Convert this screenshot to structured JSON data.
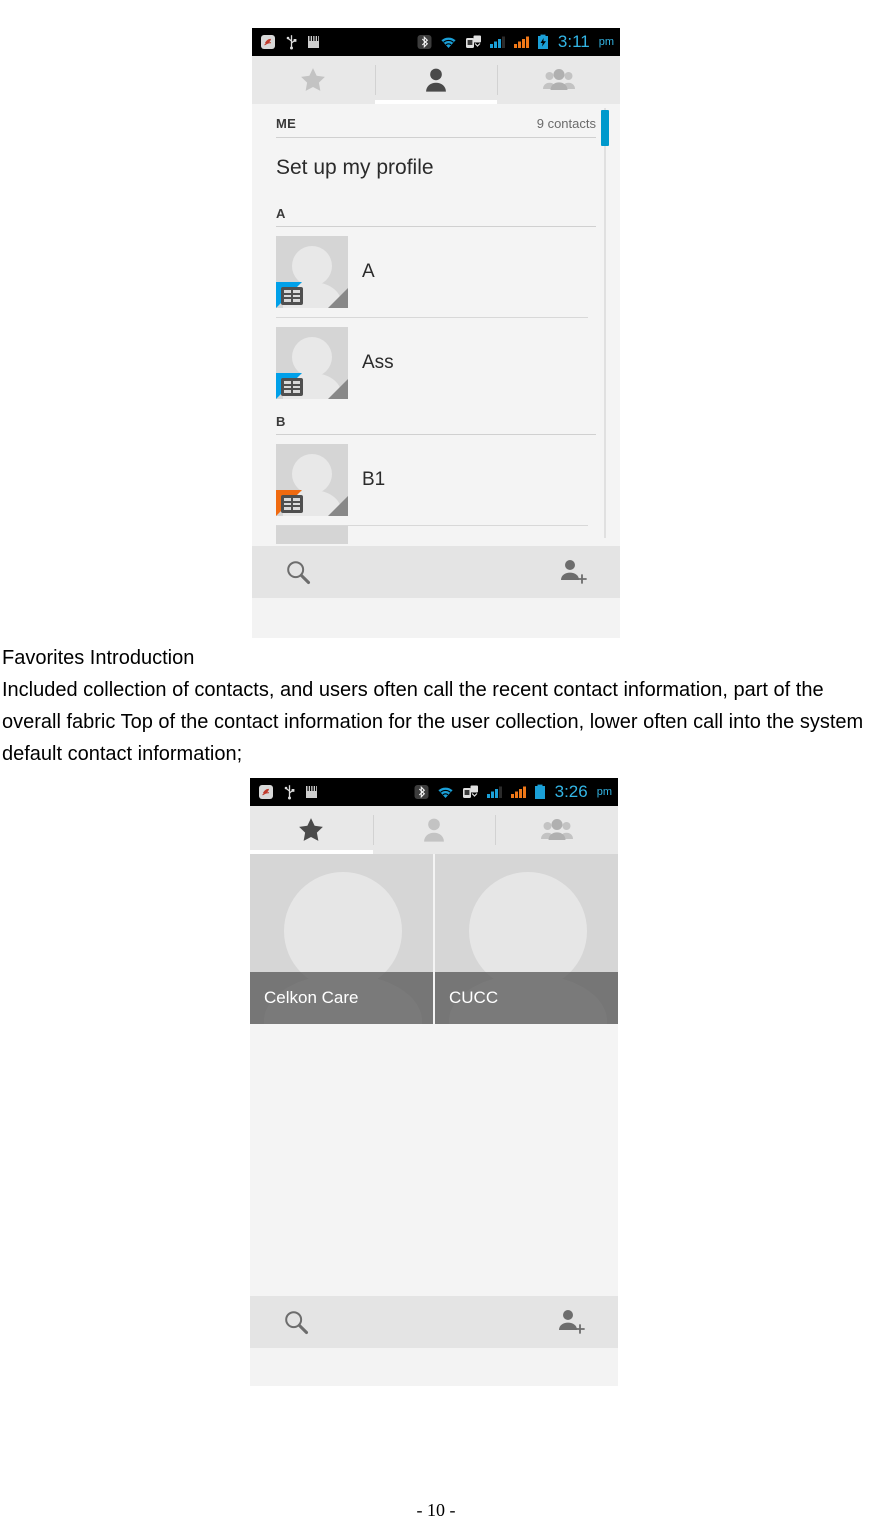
{
  "document": {
    "body_paragraphs": [
      "Favorites Introduction",
      "Included collection of contacts, and users often call the recent contact information, part of the overall fabric Top of the contact information for the user collection, lower often call into the system default contact information;"
    ],
    "heading": "Favorites Introduction",
    "paragraph": "Included collection of contacts, and users often call the recent contact information, part of the overall fabric Top of the contact information for the user collection, lower often call into the system default contact information;",
    "page_number": "- 10 -"
  },
  "screenshot_contacts": {
    "status_bar": {
      "time": "3:11",
      "ampm": "pm",
      "icons_left": [
        "app-notification-icon",
        "usb-icon",
        "sd-card-icon"
      ],
      "icons_right": [
        "bluetooth-icon",
        "wifi-icon",
        "sync-icon",
        "signal-sim1-icon",
        "signal-sim2-icon",
        "battery-charging-icon"
      ],
      "time_color": "#33b5e5",
      "battery_state": "charging"
    },
    "tabs": [
      {
        "name": "favorites",
        "icon": "star-icon",
        "active": false
      },
      {
        "name": "contacts",
        "icon": "person-icon",
        "active": true
      },
      {
        "name": "groups",
        "icon": "group-icon",
        "active": false
      }
    ],
    "active_tab_index": 1,
    "me_section": {
      "label": "ME",
      "count": "9 contacts",
      "profile_action": "Set up my profile"
    },
    "sections": [
      {
        "letter": "A",
        "contacts": [
          {
            "name": "A",
            "badge": "sim1",
            "badge_color": "#00a0e9"
          },
          {
            "name": "Ass",
            "badge": "sim1",
            "badge_color": "#00a0e9"
          }
        ]
      },
      {
        "letter": "B",
        "contacts": [
          {
            "name": "B1",
            "badge": "sim2",
            "badge_color": "#f06a10"
          }
        ]
      }
    ],
    "scrollbar": {
      "color": "#0099cc",
      "position": "top"
    },
    "action_bar": {
      "search_icon": "search-icon",
      "add_contact_icon": "add-contact-icon"
    }
  },
  "screenshot_favorites": {
    "status_bar": {
      "time": "3:26",
      "ampm": "pm",
      "icons_left": [
        "app-notification-icon",
        "usb-icon",
        "sd-card-icon"
      ],
      "icons_right": [
        "bluetooth-icon",
        "wifi-icon",
        "sync-icon",
        "signal-sim1-icon",
        "signal-sim2-icon",
        "battery-full-icon"
      ],
      "time_color": "#33b5e5",
      "battery_state": "full"
    },
    "tabs": [
      {
        "name": "favorites",
        "icon": "star-icon",
        "active": true
      },
      {
        "name": "contacts",
        "icon": "person-icon",
        "active": false
      },
      {
        "name": "groups",
        "icon": "group-icon",
        "active": false
      }
    ],
    "active_tab_index": 0,
    "favorite_tiles": [
      {
        "name": "Celkon Care"
      },
      {
        "name": "CUCC"
      }
    ],
    "action_bar": {
      "search_icon": "search-icon",
      "add_contact_icon": "add-contact-icon"
    }
  }
}
